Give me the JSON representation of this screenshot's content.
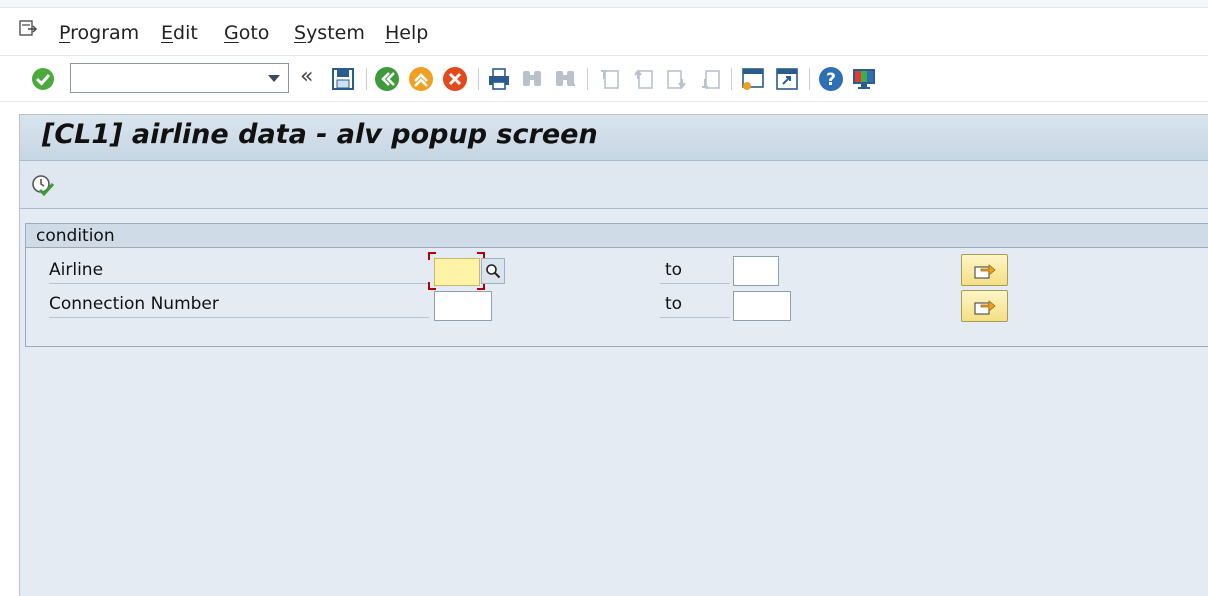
{
  "menu": {
    "items": [
      {
        "label": "Program",
        "key": "P"
      },
      {
        "label": "Edit",
        "key": "E"
      },
      {
        "label": "Goto",
        "key": "G"
      },
      {
        "label": "System",
        "key": "S"
      },
      {
        "label": "Help",
        "key": "H"
      }
    ]
  },
  "toolbar": {
    "command_field_value": "",
    "icons": [
      "enter-icon",
      "command-field-dropdown",
      "collapse-icon",
      "save-icon",
      "back-icon",
      "exit-icon",
      "cancel-icon",
      "print-icon",
      "find-icon",
      "find-next-icon",
      "first-page-icon",
      "previous-page-icon",
      "next-page-icon",
      "last-page-icon",
      "create-session-icon",
      "shortcut-icon",
      "help-icon",
      "customize-layout-icon"
    ]
  },
  "window": {
    "title": "[CL1] airline data - alv popup screen",
    "app_toolbar": {
      "execute_icon": "execute-icon"
    }
  },
  "group": {
    "title": "condition",
    "rows": [
      {
        "label": "Airline",
        "low_value": "",
        "to_label": "to",
        "high_value": ""
      },
      {
        "label": "Connection Number",
        "low_value": "",
        "to_label": "to",
        "high_value": ""
      }
    ]
  },
  "colors": {
    "title_bg": "#cfdbe7",
    "content_bg": "#e4ebf3",
    "focused_field": "#fff3a8",
    "focus_frame": "#b30000"
  }
}
